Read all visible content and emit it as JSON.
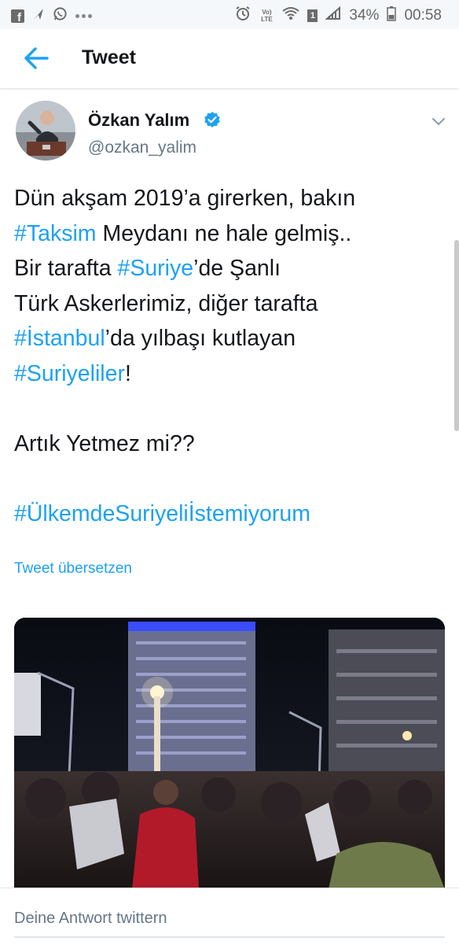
{
  "status_bar": {
    "left_icons": [
      "facebook-icon",
      "navigation-icon",
      "whatsapp-icon",
      "dots-icon"
    ],
    "right_icons": [
      "alarm-icon",
      "volte-icon",
      "wifi-icon",
      "sim1-icon",
      "signal-icon",
      "battery-icon"
    ],
    "volte_label": "Vo) LTE",
    "battery": "34%",
    "time": "00:58"
  },
  "header": {
    "title": "Tweet"
  },
  "tweet": {
    "author_name": "Özkan Yalım",
    "handle": "@ozkan_yalim",
    "lines": [
      [
        {
          "t": "Dün akşam 2019’a girerken, bakın",
          "h": false
        }
      ],
      [
        {
          "t": "#Taksim",
          "h": true
        },
        {
          "t": " Meydanı ne hale gelmiş..",
          "h": false
        }
      ],
      [
        {
          "t": "Bir tarafta ",
          "h": false
        },
        {
          "t": "#Suriye",
          "h": true
        },
        {
          "t": "’de Şanlı",
          "h": false
        }
      ],
      [
        {
          "t": "Türk Askerlerimiz, diğer tarafta",
          "h": false
        }
      ],
      [
        {
          "t": "#İstanbul",
          "h": true
        },
        {
          "t": "’da yılbaşı kutlayan",
          "h": false
        }
      ],
      [
        {
          "t": "#Suriyeliler",
          "h": true
        },
        {
          "t": "!",
          "h": false
        }
      ],
      null,
      [
        {
          "t": "Artık Yetmez mi??",
          "h": false
        }
      ],
      null,
      [
        {
          "t": "#ÜlkemdeSuriyeliİstemiyorum",
          "h": true
        }
      ]
    ],
    "translate_label": "Tweet übersetzen"
  },
  "colors": {
    "link": "#1da1f2",
    "text": "#14171a",
    "secondary": "#657786"
  },
  "reply": {
    "placeholder": "Deine Antwort twittern"
  }
}
